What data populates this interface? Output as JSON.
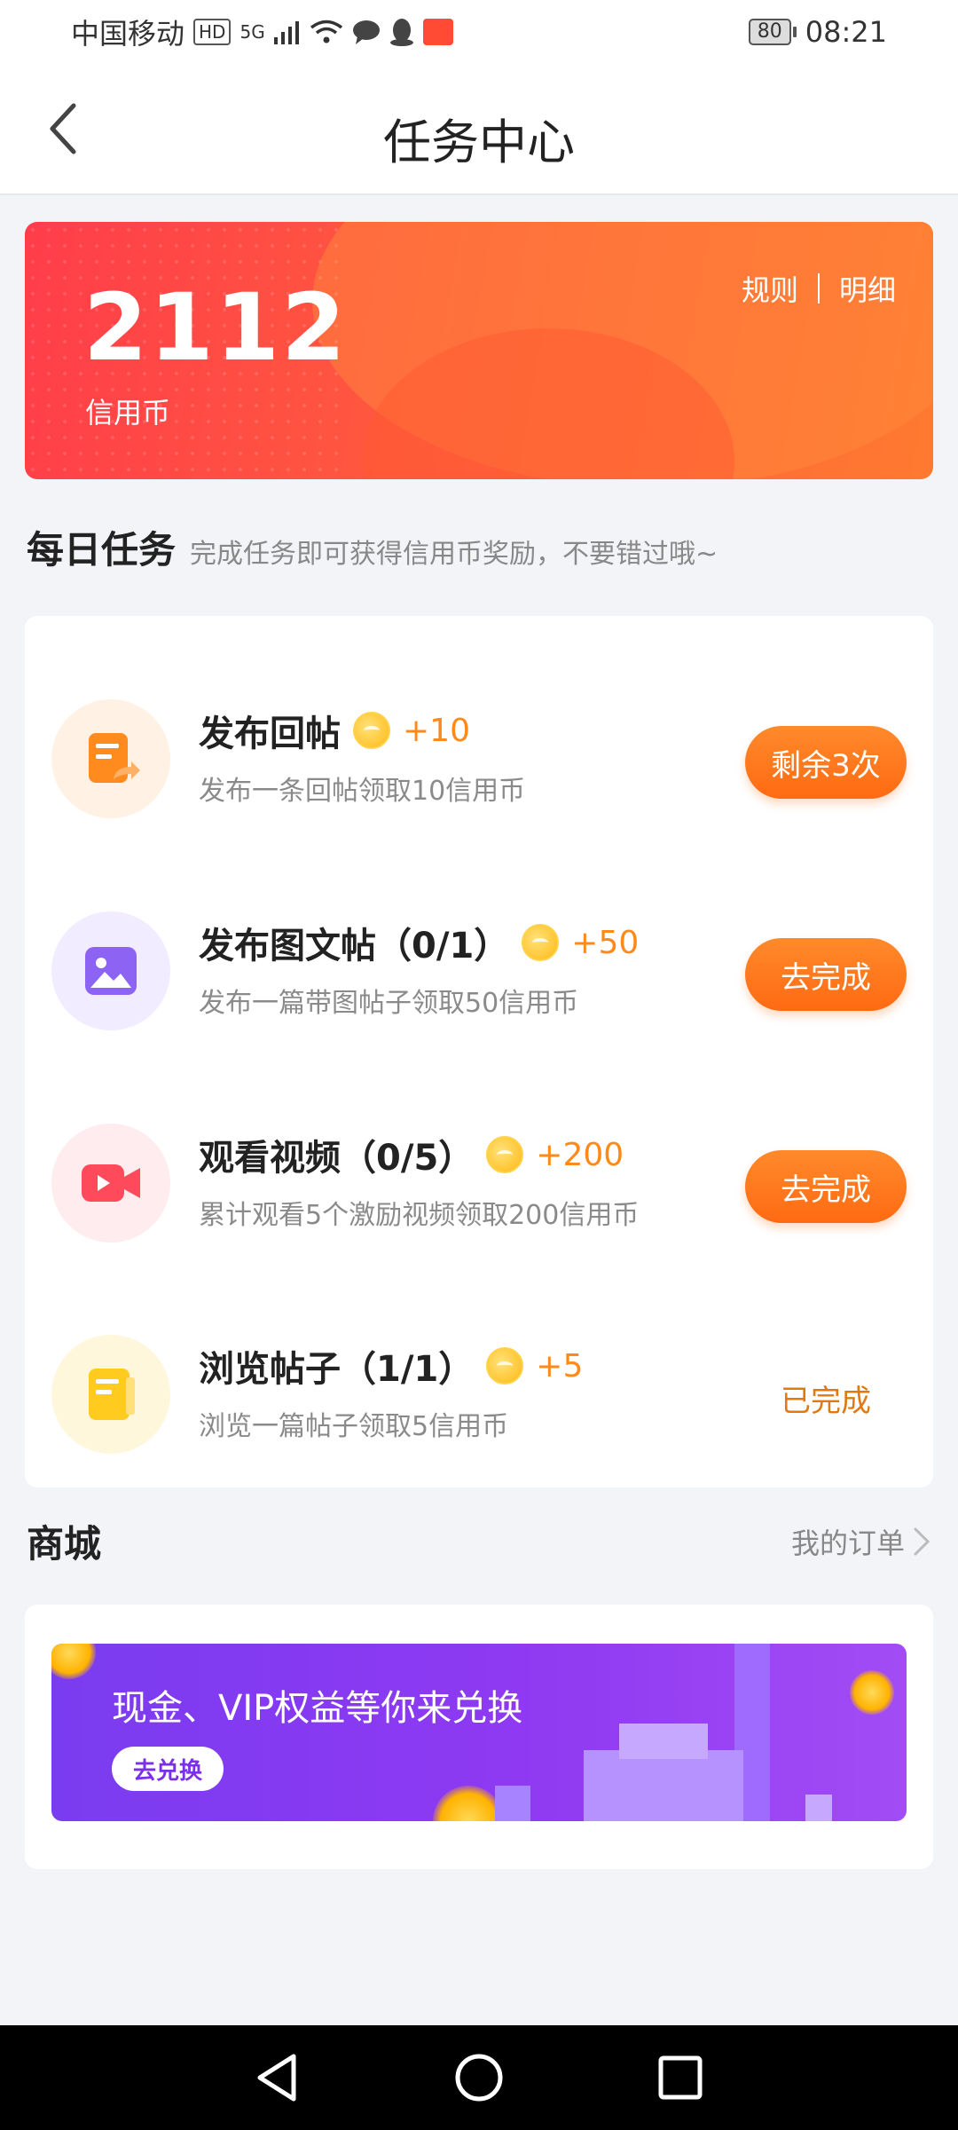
{
  "status": {
    "carrier": "中国移动",
    "hd": "HD",
    "net": "5G",
    "battery": "80",
    "time": "08:21"
  },
  "header": {
    "title": "任务中心"
  },
  "credit": {
    "amount": "2112",
    "unit": "信用币",
    "rules_label": "规则",
    "detail_label": "明细"
  },
  "daily": {
    "title": "每日任务",
    "subtitle": "完成任务即可获得信用币奖励，不要错过哦~"
  },
  "tasks": [
    {
      "title": "发布回帖",
      "reward": "+10",
      "desc": "发布一条回帖领取10信用币",
      "action": "剩余3次",
      "icon": "edit-post-icon",
      "done": false
    },
    {
      "title": "发布图文帖（0/1）",
      "reward": "+50",
      "desc": "发布一篇带图帖子领取50信用币",
      "action": "去完成",
      "icon": "image-icon",
      "done": false
    },
    {
      "title": "观看视频（0/5）",
      "reward": "+200",
      "desc": "累计观看5个激励视频领取200信用币",
      "action": "去完成",
      "icon": "video-icon",
      "done": false
    },
    {
      "title": "浏览帖子（1/1）",
      "reward": "+5",
      "desc": "浏览一篇帖子领取5信用币",
      "action": "已完成",
      "icon": "document-icon",
      "done": true
    }
  ],
  "shop": {
    "title": "商城",
    "orders_label": "我的订单",
    "banner_title": "现金、VIP权益等你来兑换",
    "banner_button": "去兑换"
  },
  "colors": {
    "accent": "#ff6a12",
    "card_start": "#ff3d4a",
    "card_end": "#ff7a30",
    "banner": "#8f39f2",
    "done_text": "#e07a10"
  }
}
